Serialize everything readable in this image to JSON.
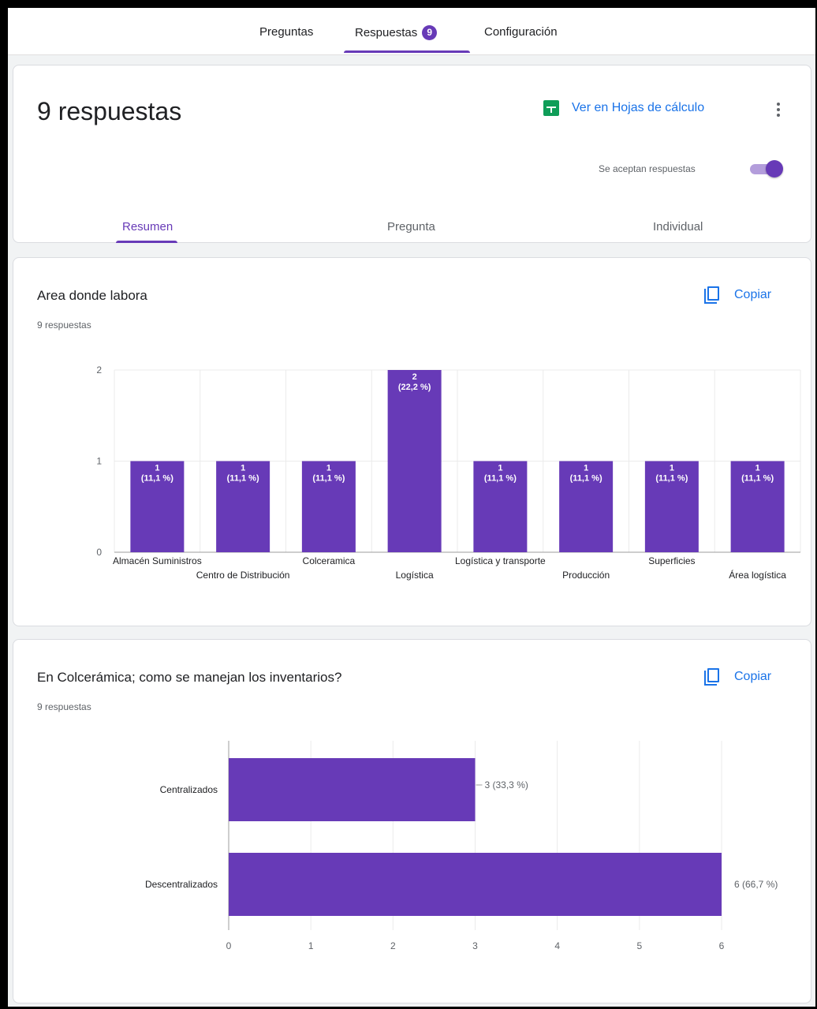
{
  "nav": {
    "tabs": [
      "Preguntas",
      "Respuestas",
      "Configuración"
    ],
    "response_count": "9"
  },
  "summary": {
    "title": "9 respuestas",
    "sheets_link": "Ver en Hojas de cálculo",
    "more_icon": "more-vert-icon",
    "accepting_label": "Se aceptan respuestas",
    "accepting": true,
    "subtabs": [
      "Resumen",
      "Pregunta",
      "Individual"
    ],
    "active_subtab": "Resumen"
  },
  "questions": [
    {
      "title": "Area donde labora",
      "count": "9 respuestas",
      "copy_label": "Copiar"
    },
    {
      "title": "En Colcerámica; como se manejan los  inventarios?",
      "count": "9 respuestas",
      "copy_label": "Copiar"
    }
  ],
  "colors": {
    "accent": "#673ab7",
    "link": "#1a73e8",
    "sheets": "#0f9d58"
  },
  "chart_data": [
    {
      "type": "bar",
      "categories": [
        "Almacén Suministros",
        "Centro de Distribución",
        "Colceramica",
        "Logística",
        "Logística y transporte",
        "Producción",
        "Superficies",
        "Área logística"
      ],
      "values": [
        1,
        1,
        1,
        2,
        1,
        1,
        1,
        1
      ],
      "data_labels": [
        "1 (11,1 %)",
        "1 (11,1 %)",
        "1 (11,1 %)",
        "2 (22,2 %)",
        "1 (11,1 %)",
        "1 (11,1 %)",
        "1 (11,1 %)",
        "1 (11,1 %)"
      ],
      "yticks": [
        "0",
        "1",
        "2"
      ],
      "ylim": [
        0,
        2
      ],
      "grid": true,
      "color": "#673ab7"
    },
    {
      "type": "bar",
      "orientation": "horizontal",
      "categories": [
        "Centralizados",
        "Descentralizados"
      ],
      "values": [
        3,
        6
      ],
      "data_labels": [
        "3 (33,3 %)",
        "6 (66,7 %)"
      ],
      "xticks": [
        "0",
        "1",
        "2",
        "3",
        "4",
        "5",
        "6"
      ],
      "xlim": [
        0,
        6
      ],
      "grid": true,
      "color": "#673ab7"
    }
  ]
}
